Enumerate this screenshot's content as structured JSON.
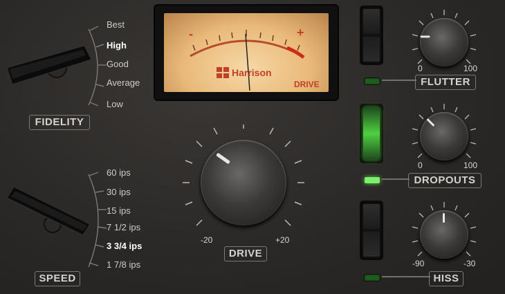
{
  "meter": {
    "brand": "Harrison",
    "tag": "DRIVE",
    "minus": "-",
    "plus": "+"
  },
  "fidelity": {
    "label": "FIDELITY",
    "options": [
      "Best",
      "High",
      "Good",
      "Average",
      "Low"
    ],
    "selected": "High"
  },
  "speed": {
    "label": "SPEED",
    "options": [
      "60 ips",
      "30 ips",
      "15 ips",
      "7 1/2 ips",
      "3 3/4 ips",
      "1 7/8 ips"
    ],
    "selected": "3 3/4 ips"
  },
  "drive": {
    "label": "DRIVE",
    "min": "-20",
    "max": "+20"
  },
  "flutter": {
    "label": "FLUTTER",
    "min": "0",
    "max": "100",
    "enabled": false
  },
  "dropouts": {
    "label": "DROPOUTS",
    "min": "0",
    "max": "100",
    "enabled": true
  },
  "hiss": {
    "label": "HISS",
    "min": "-90",
    "max": "-30",
    "enabled": false
  },
  "colors": {
    "accent_red": "#c0402a",
    "led_on": "#7cf06a",
    "led_off": "#1e5d1e",
    "label_text": "#d6d3cf"
  }
}
